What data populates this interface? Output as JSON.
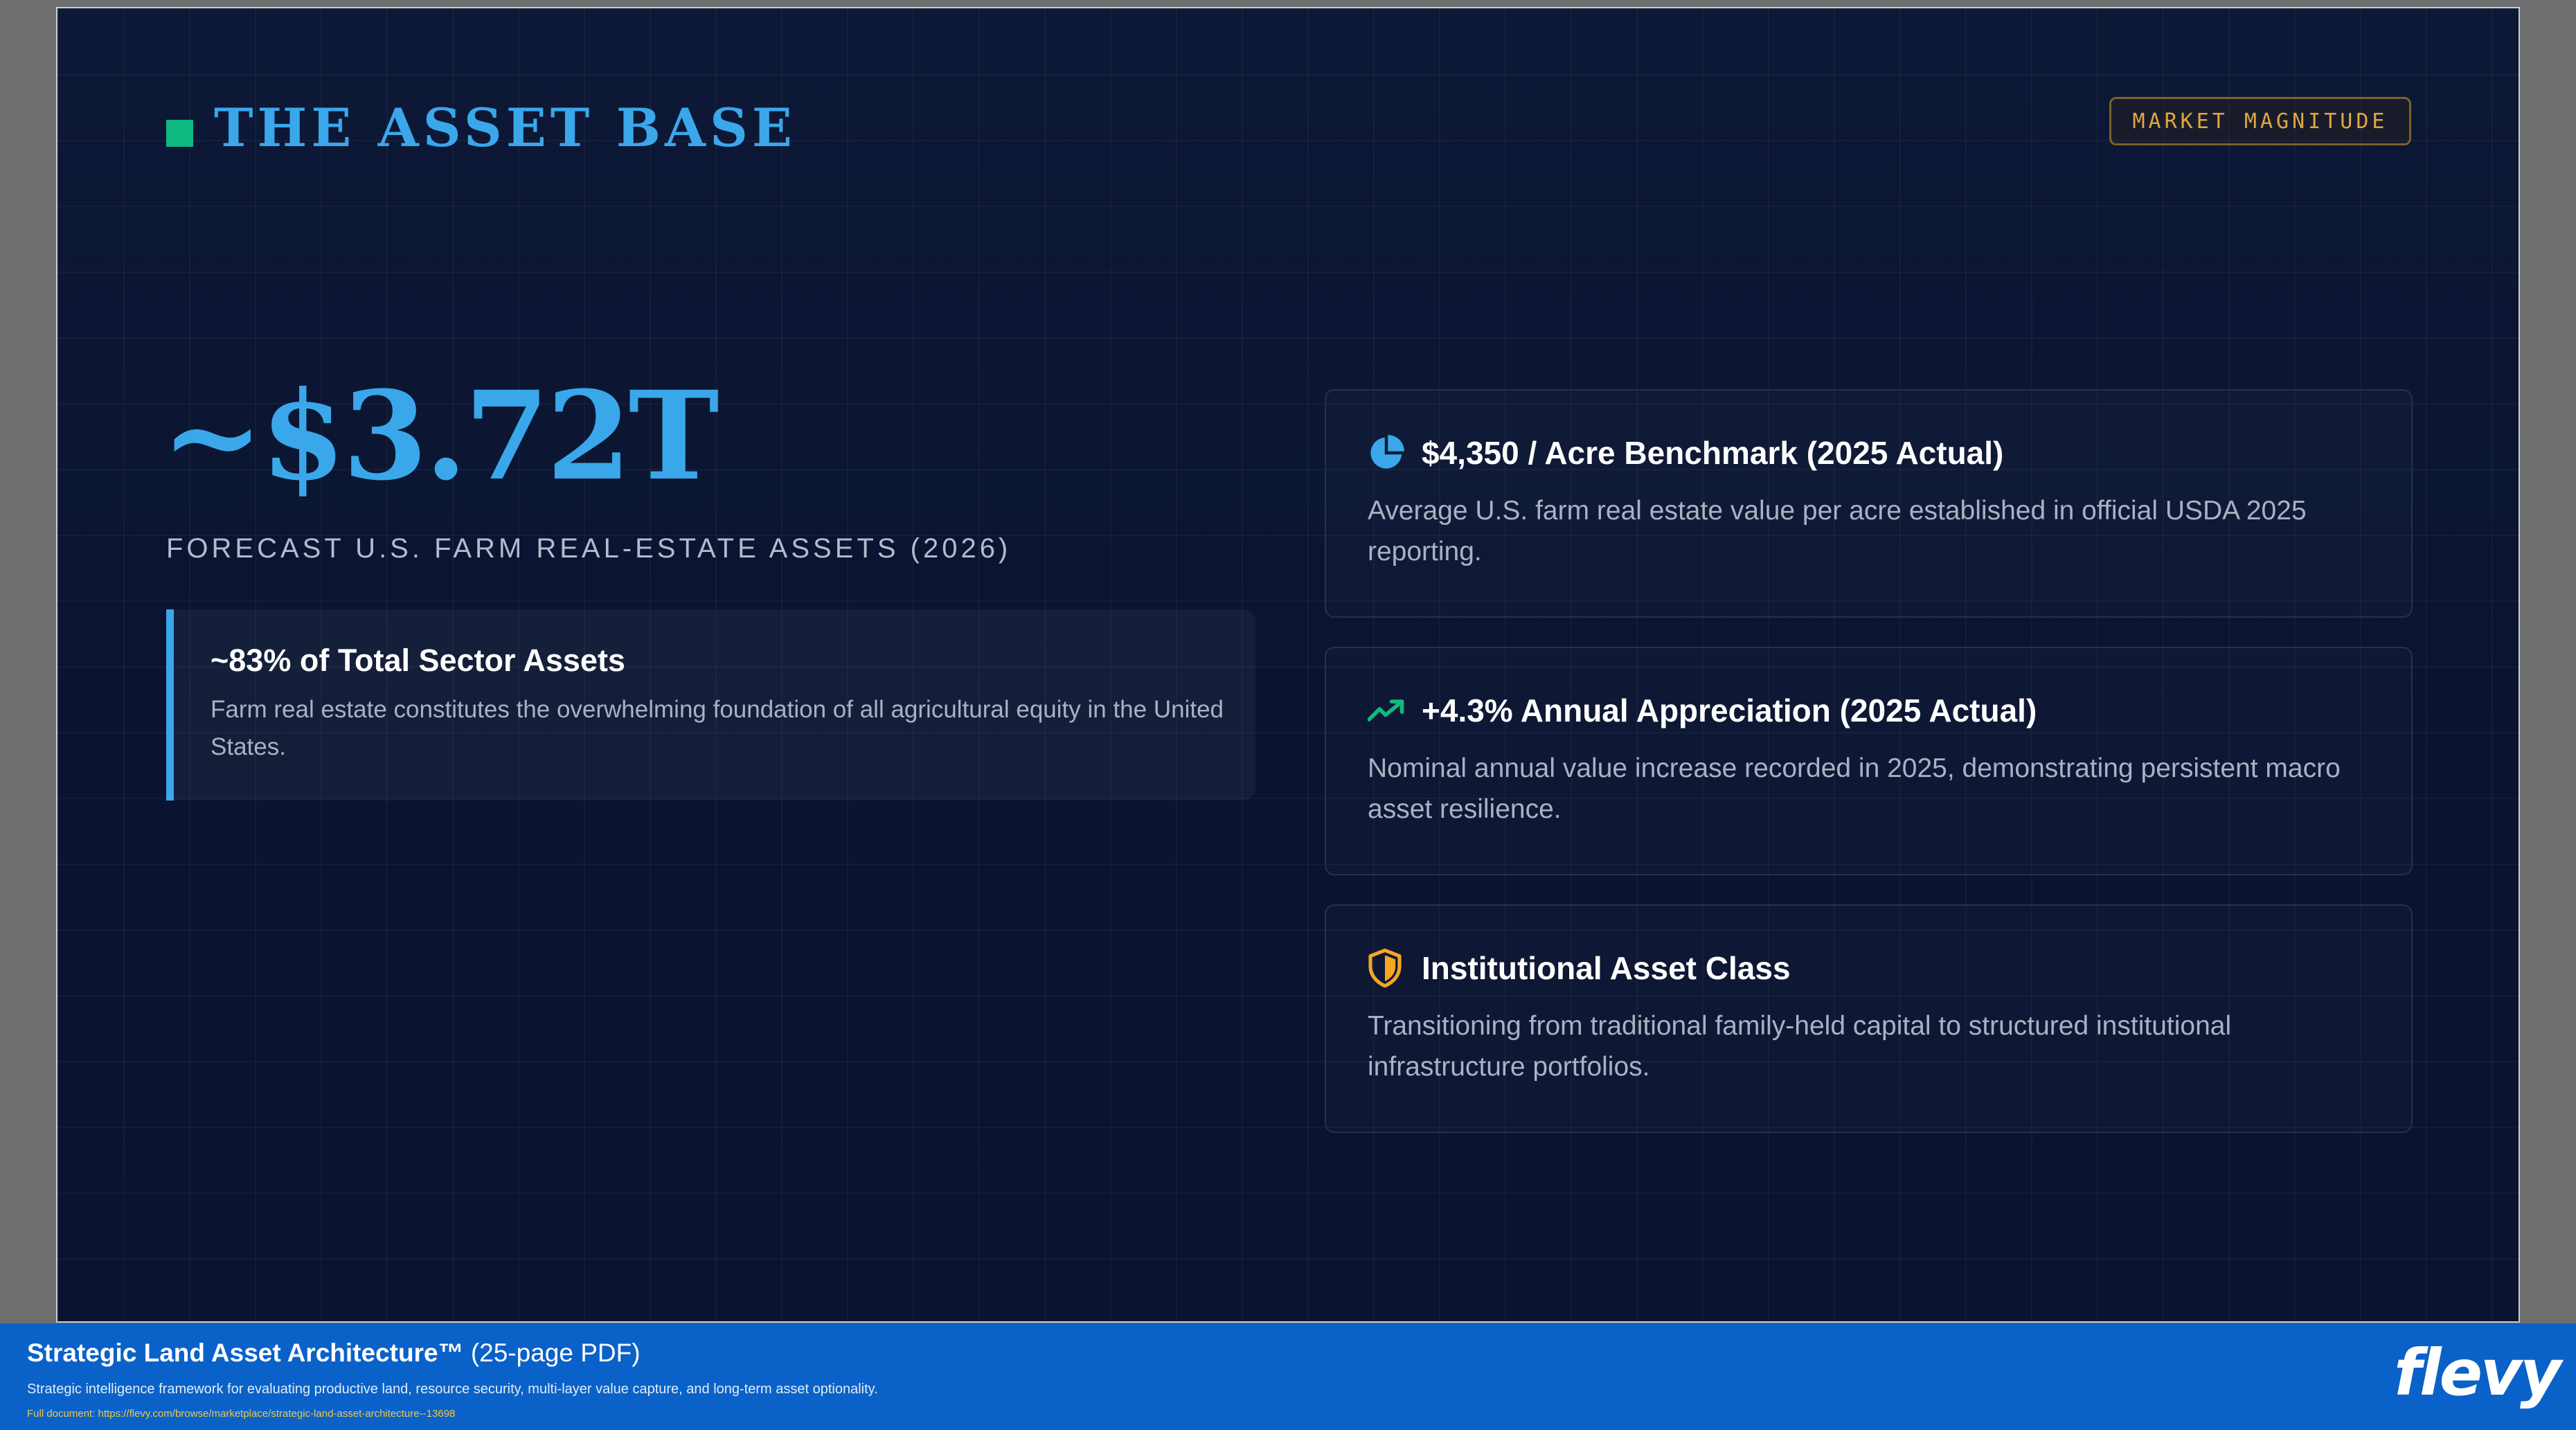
{
  "header": {
    "title": "THE ASSET BASE",
    "tag": "MARKET MAGNITUDE",
    "accent_color": "#10b981"
  },
  "headline": {
    "value": "~$3.72T",
    "label": "FORECAST U.S. FARM REAL-ESTATE ASSETS (2026)"
  },
  "highlight": {
    "title": "~83% of Total Sector Assets",
    "body": "Farm real estate constitutes the overwhelming foundation of all agricultural equity in the United States."
  },
  "cards": [
    {
      "icon": "pie-chart-icon",
      "icon_color": "#3aa7ea",
      "title": "$4,350 / Acre Benchmark (2025 Actual)",
      "body": "Average U.S. farm real estate value per acre established in official USDA 2025 reporting."
    },
    {
      "icon": "trending-up-icon",
      "icon_color": "#10b981",
      "title": "+4.3% Annual Appreciation (2025 Actual)",
      "body": "Nominal annual value increase recorded in 2025, demonstrating persistent macro asset resilience."
    },
    {
      "icon": "shield-icon",
      "icon_color": "#f5a623",
      "title": "Institutional Asset Class",
      "body": "Transitioning from traditional family-held capital to structured institutional infrastructure portfolios."
    }
  ],
  "footer": {
    "title": "Strategic Land Asset Architecture™",
    "pages": "(25-page PDF)",
    "description": "Strategic intelligence framework for evaluating productive land, resource security, multi-layer value capture, and long-term asset optionality.",
    "link": "Full document: https://flevy.com/browse/marketplace/strategic-land-asset-architecture--13698",
    "logo": "flevy"
  }
}
